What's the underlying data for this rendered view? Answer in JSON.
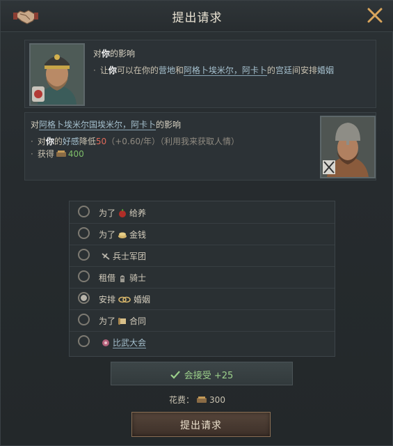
{
  "header": {
    "title": "提出请求",
    "left_icon": "handshake-icon",
    "close_icon": "close-icon"
  },
  "impact_self": {
    "title_prefix": "对",
    "title_you": "你",
    "title_suffix": "的影响",
    "line_prefix": "让",
    "line_you": "你",
    "line_mid1": "可以在你的",
    "line_camp": "营地",
    "line_and": "和",
    "line_person": "阿格卜埃米尔，阿卡卜",
    "line_mid2": "的",
    "line_court": "宫廷",
    "line_mid3": "间安排",
    "line_marriage": "婚姻"
  },
  "impact_other": {
    "title_prefix": "对",
    "title_person": "阿格卜埃米尔国埃米尔，阿卡卜",
    "title_suffix": "的影响",
    "line1_prefix": "对",
    "line1_you": "你",
    "line1_mid": "的",
    "line1_opinion": "好感",
    "line1_reduce": "降低",
    "line1_value": "50",
    "line1_rate": "（+0.60/年）",
    "line1_note": "（利用我来获取人情）",
    "line2_prefix": "获得",
    "line2_value": "400"
  },
  "options": [
    {
      "label": "为了",
      "icon": "apple-icon",
      "item": "给养",
      "selected": false
    },
    {
      "label": "为了",
      "icon": "coins-icon",
      "item": "金钱",
      "selected": false
    },
    {
      "label": "",
      "icon": "soldier-icon",
      "item": "兵士军团",
      "selected": false
    },
    {
      "label": "租借",
      "icon": "knight-icon",
      "item": "骑士",
      "selected": false
    },
    {
      "label": "安排",
      "icon": "rings-icon",
      "item": "婚姻",
      "selected": true
    },
    {
      "label": "为了",
      "icon": "scroll-icon",
      "item": "合同",
      "selected": false
    },
    {
      "label": "",
      "icon": "tournament-icon",
      "item": "比武大会",
      "selected": false
    }
  ],
  "acceptance": {
    "text": "会接受 +25",
    "icon": "checkmark-icon"
  },
  "cost": {
    "label": "花费：",
    "value": "300",
    "icon": "treasury-icon"
  },
  "submit_label": "提出请求",
  "colors": {
    "accent_green": "#9cd08b",
    "accent_red": "#e06a5a",
    "link_blue": "#a6c1cf"
  }
}
